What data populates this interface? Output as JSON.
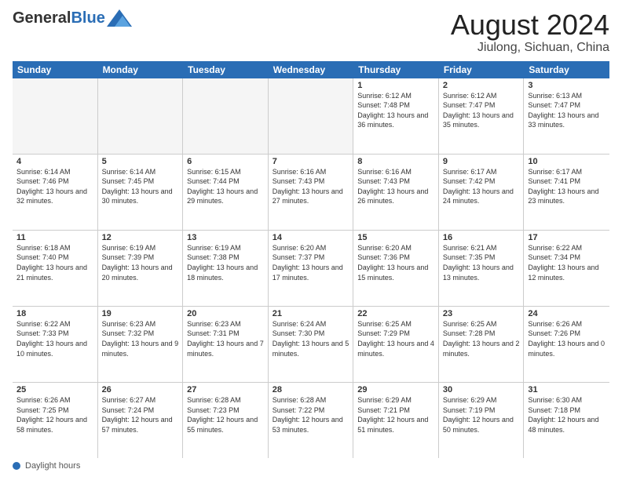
{
  "header": {
    "logo_general": "General",
    "logo_blue": "Blue",
    "title": "August 2024",
    "subtitle": "Jiulong, Sichuan, China"
  },
  "days_of_week": [
    "Sunday",
    "Monday",
    "Tuesday",
    "Wednesday",
    "Thursday",
    "Friday",
    "Saturday"
  ],
  "weeks": [
    [
      {
        "day": "",
        "empty": true
      },
      {
        "day": "",
        "empty": true
      },
      {
        "day": "",
        "empty": true
      },
      {
        "day": "",
        "empty": true
      },
      {
        "day": "1",
        "sunrise": "6:12 AM",
        "sunset": "7:48 PM",
        "daylight": "13 hours and 36 minutes."
      },
      {
        "day": "2",
        "sunrise": "6:12 AM",
        "sunset": "7:47 PM",
        "daylight": "13 hours and 35 minutes."
      },
      {
        "day": "3",
        "sunrise": "6:13 AM",
        "sunset": "7:47 PM",
        "daylight": "13 hours and 33 minutes."
      }
    ],
    [
      {
        "day": "4",
        "sunrise": "6:14 AM",
        "sunset": "7:46 PM",
        "daylight": "13 hours and 32 minutes."
      },
      {
        "day": "5",
        "sunrise": "6:14 AM",
        "sunset": "7:45 PM",
        "daylight": "13 hours and 30 minutes."
      },
      {
        "day": "6",
        "sunrise": "6:15 AM",
        "sunset": "7:44 PM",
        "daylight": "13 hours and 29 minutes."
      },
      {
        "day": "7",
        "sunrise": "6:16 AM",
        "sunset": "7:43 PM",
        "daylight": "13 hours and 27 minutes."
      },
      {
        "day": "8",
        "sunrise": "6:16 AM",
        "sunset": "7:43 PM",
        "daylight": "13 hours and 26 minutes."
      },
      {
        "day": "9",
        "sunrise": "6:17 AM",
        "sunset": "7:42 PM",
        "daylight": "13 hours and 24 minutes."
      },
      {
        "day": "10",
        "sunrise": "6:17 AM",
        "sunset": "7:41 PM",
        "daylight": "13 hours and 23 minutes."
      }
    ],
    [
      {
        "day": "11",
        "sunrise": "6:18 AM",
        "sunset": "7:40 PM",
        "daylight": "13 hours and 21 minutes."
      },
      {
        "day": "12",
        "sunrise": "6:19 AM",
        "sunset": "7:39 PM",
        "daylight": "13 hours and 20 minutes."
      },
      {
        "day": "13",
        "sunrise": "6:19 AM",
        "sunset": "7:38 PM",
        "daylight": "13 hours and 18 minutes."
      },
      {
        "day": "14",
        "sunrise": "6:20 AM",
        "sunset": "7:37 PM",
        "daylight": "13 hours and 17 minutes."
      },
      {
        "day": "15",
        "sunrise": "6:20 AM",
        "sunset": "7:36 PM",
        "daylight": "13 hours and 15 minutes."
      },
      {
        "day": "16",
        "sunrise": "6:21 AM",
        "sunset": "7:35 PM",
        "daylight": "13 hours and 13 minutes."
      },
      {
        "day": "17",
        "sunrise": "6:22 AM",
        "sunset": "7:34 PM",
        "daylight": "13 hours and 12 minutes."
      }
    ],
    [
      {
        "day": "18",
        "sunrise": "6:22 AM",
        "sunset": "7:33 PM",
        "daylight": "13 hours and 10 minutes."
      },
      {
        "day": "19",
        "sunrise": "6:23 AM",
        "sunset": "7:32 PM",
        "daylight": "13 hours and 9 minutes."
      },
      {
        "day": "20",
        "sunrise": "6:23 AM",
        "sunset": "7:31 PM",
        "daylight": "13 hours and 7 minutes."
      },
      {
        "day": "21",
        "sunrise": "6:24 AM",
        "sunset": "7:30 PM",
        "daylight": "13 hours and 5 minutes."
      },
      {
        "day": "22",
        "sunrise": "6:25 AM",
        "sunset": "7:29 PM",
        "daylight": "13 hours and 4 minutes."
      },
      {
        "day": "23",
        "sunrise": "6:25 AM",
        "sunset": "7:28 PM",
        "daylight": "13 hours and 2 minutes."
      },
      {
        "day": "24",
        "sunrise": "6:26 AM",
        "sunset": "7:26 PM",
        "daylight": "13 hours and 0 minutes."
      }
    ],
    [
      {
        "day": "25",
        "sunrise": "6:26 AM",
        "sunset": "7:25 PM",
        "daylight": "12 hours and 58 minutes."
      },
      {
        "day": "26",
        "sunrise": "6:27 AM",
        "sunset": "7:24 PM",
        "daylight": "12 hours and 57 minutes."
      },
      {
        "day": "27",
        "sunrise": "6:28 AM",
        "sunset": "7:23 PM",
        "daylight": "12 hours and 55 minutes."
      },
      {
        "day": "28",
        "sunrise": "6:28 AM",
        "sunset": "7:22 PM",
        "daylight": "12 hours and 53 minutes."
      },
      {
        "day": "29",
        "sunrise": "6:29 AM",
        "sunset": "7:21 PM",
        "daylight": "12 hours and 51 minutes."
      },
      {
        "day": "30",
        "sunrise": "6:29 AM",
        "sunset": "7:19 PM",
        "daylight": "12 hours and 50 minutes."
      },
      {
        "day": "31",
        "sunrise": "6:30 AM",
        "sunset": "7:18 PM",
        "daylight": "12 hours and 48 minutes."
      }
    ]
  ],
  "footer": {
    "label": "Daylight hours"
  }
}
